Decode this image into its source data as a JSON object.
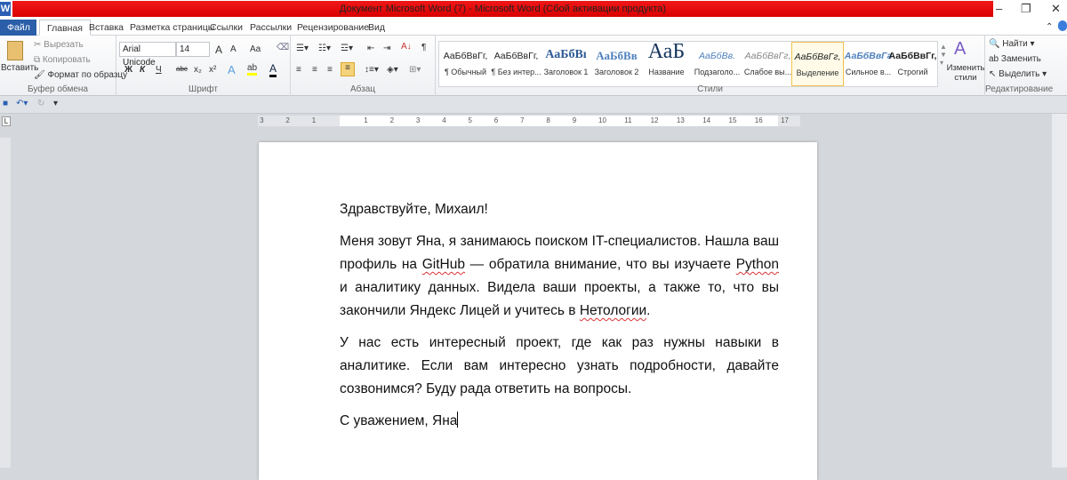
{
  "window": {
    "title": "Документ Microsoft Word (7)  -  Microsoft Word (Сбой активации продукта)",
    "app_icon": "W"
  },
  "tabs": [
    "Файл",
    "Главная",
    "Вставка",
    "Разметка страницы",
    "Ссылки",
    "Рассылки",
    "Рецензирование",
    "Вид"
  ],
  "clipboard": {
    "paste": "Вставить",
    "cut": "Вырезать",
    "copy": "Копировать",
    "format_painter": "Формат по образцу",
    "label": "Буфер обмена"
  },
  "font": {
    "name": "Arial Unicode",
    "size": "14",
    "label": "Шрифт",
    "bold": "Ж",
    "italic": "К",
    "underline": "Ч",
    "strike": "abc",
    "sub": "x₂",
    "sup": "x²",
    "grow": "A",
    "shrink": "A",
    "case": "Aa"
  },
  "paragraph": {
    "label": "Абзац"
  },
  "styles": {
    "label": "Стили",
    "change": "Изменить стили",
    "items": [
      {
        "preview": "АаБбВвГг,",
        "name": "¶ Обычный"
      },
      {
        "preview": "АаБбВвГг,",
        "name": "¶ Без интер..."
      },
      {
        "preview": "АаБбВı",
        "name": "Заголовок 1"
      },
      {
        "preview": "АаБбВв",
        "name": "Заголовок 2"
      },
      {
        "preview": "АаБ",
        "name": "Название"
      },
      {
        "preview": "АаБбВв.",
        "name": "Подзаголо..."
      },
      {
        "preview": "АаБбВвГг,",
        "name": "Слабое вы..."
      },
      {
        "preview": "АаБбВвГг,",
        "name": "Выделение"
      },
      {
        "preview": "АаБбВвГг",
        "name": "Сильное в..."
      },
      {
        "preview": "АаБбВвГг,",
        "name": "Строгий"
      }
    ]
  },
  "editing": {
    "label": "Редактирование",
    "find": "Найти",
    "replace": "Заменить",
    "select": "Выделить"
  },
  "ruler": [
    "3",
    "2",
    "1",
    "1",
    "2",
    "3",
    "4",
    "5",
    "6",
    "7",
    "8",
    "9",
    "10",
    "11",
    "12",
    "13",
    "14",
    "15",
    "16",
    "17"
  ],
  "document": {
    "greeting": "Здравствуйте, Михаил!",
    "p1": [
      "Меня зовут Яна, я занимаюсь поиском IT-специалистов. Нашла ваш профиль на ",
      "GitHub",
      " — обратила внимание, что вы изучаете ",
      "Python",
      " и аналитику данных. Видела ваши проекты, а также то, что вы закончили Яндекс Лицей и учитесь в ",
      "Нетологии",
      "."
    ],
    "p2": "У нас есть интересный проект, где как раз нужны навыки в аналитике. Если вам интересно узнать подробности, давайте созвонимся? Буду рада ответить на вопросы.",
    "sign": "С уважением, Яна"
  }
}
